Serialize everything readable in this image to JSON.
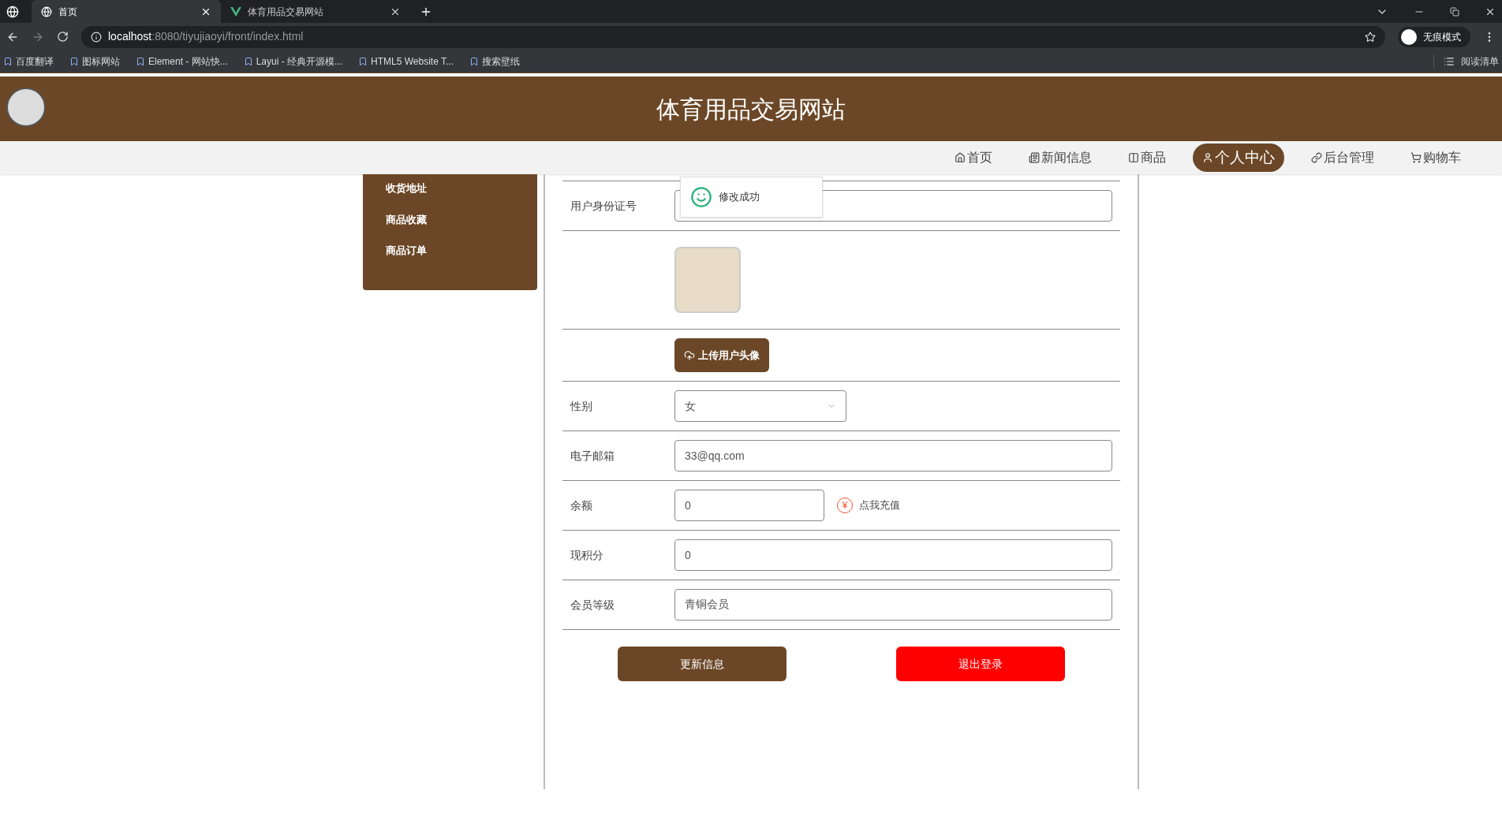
{
  "browser": {
    "tabs": [
      {
        "title": "首页",
        "selected": true
      },
      {
        "title": "体育用品交易网站",
        "selected": false
      }
    ],
    "url_host": "localhost",
    "url_rest": ":8080/tiyujiaoyi/front/index.html",
    "profile": "无痕模式",
    "bookmarks": [
      "百度翻译",
      "图标网站",
      "Element - 网站快...",
      "Layui - 经典开源模...",
      "HTML5 Website T...",
      "搜索壁纸"
    ],
    "reading_list": "阅读清单"
  },
  "site": {
    "title": "体育用品交易网站"
  },
  "nav": [
    {
      "label": "首页",
      "selected": false
    },
    {
      "label": "新闻信息",
      "selected": false
    },
    {
      "label": "商品",
      "selected": false
    },
    {
      "label": "个人中心",
      "selected": true
    },
    {
      "label": "后台管理",
      "selected": false
    },
    {
      "label": "购物车",
      "selected": false
    }
  ],
  "sidebar": {
    "items": [
      "收货地址",
      "商品收藏",
      "商品订单"
    ]
  },
  "toast": {
    "message": "修改成功"
  },
  "form": [
    {
      "kind": "text",
      "label": "用户身份证号"
    },
    {
      "kind": "avatar"
    },
    {
      "kind": "upload",
      "button": "上传用户头像"
    },
    {
      "kind": "select",
      "label": "性别",
      "value": "女"
    },
    {
      "kind": "text",
      "label": "电子邮箱",
      "value": "33@qq.com"
    },
    {
      "kind": "balance",
      "label": "余额",
      "value": "0",
      "currency": "¥",
      "link": "点我充值"
    },
    {
      "kind": "text",
      "label": "现积分",
      "value": "0"
    },
    {
      "kind": "text",
      "label": "会员等级",
      "value": "青铜会员"
    }
  ],
  "actions": {
    "update": "更新信息",
    "logout": "退出登录"
  }
}
